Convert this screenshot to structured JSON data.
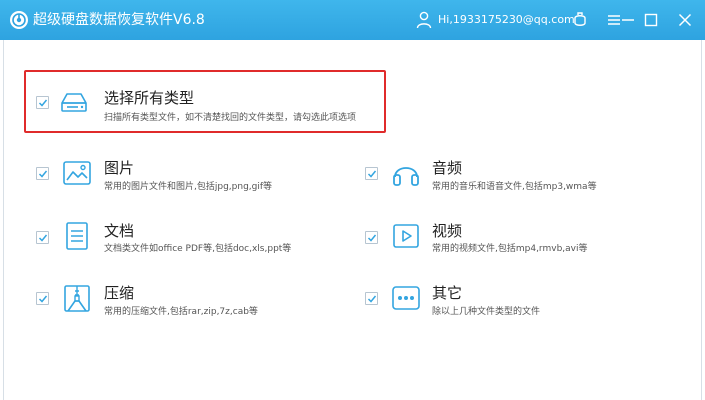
{
  "window": {
    "title": "超级硬盘数据恢复软件V6.8",
    "user": "Hi,1933175230@qq.com",
    "accent": "#2ea3e0",
    "icon_color": "#33a5e0",
    "highlight_color": "#e02b2b"
  },
  "select_all": {
    "checked": true,
    "title": "选择所有类型",
    "desc": "扫描所有类型文件，如不清楚找回的文件类型，请勾选此项选项",
    "icon": "hard-drive-icon"
  },
  "categories": [
    {
      "id": "images",
      "checked": true,
      "title": "图片",
      "desc": "常用的图片文件和图片,包括jpg,png,gif等",
      "icon": "image-icon"
    },
    {
      "id": "audio",
      "checked": true,
      "title": "音频",
      "desc": "常用的音乐和语音文件,包括mp3,wma等",
      "icon": "headphones-icon"
    },
    {
      "id": "documents",
      "checked": true,
      "title": "文档",
      "desc": "文档类文件如office PDF等,包括doc,xls,ppt等",
      "icon": "document-icon"
    },
    {
      "id": "video",
      "checked": true,
      "title": "视频",
      "desc": "常用的视频文件,包括mp4,rmvb,avi等",
      "icon": "play-icon"
    },
    {
      "id": "archives",
      "checked": true,
      "title": "压缩",
      "desc": "常用的压缩文件,包括rar,zip,7z,cab等",
      "icon": "archive-icon"
    },
    {
      "id": "other",
      "checked": true,
      "title": "其它",
      "desc": "除以上几种文件类型的文件",
      "icon": "ellipsis-icon"
    }
  ]
}
